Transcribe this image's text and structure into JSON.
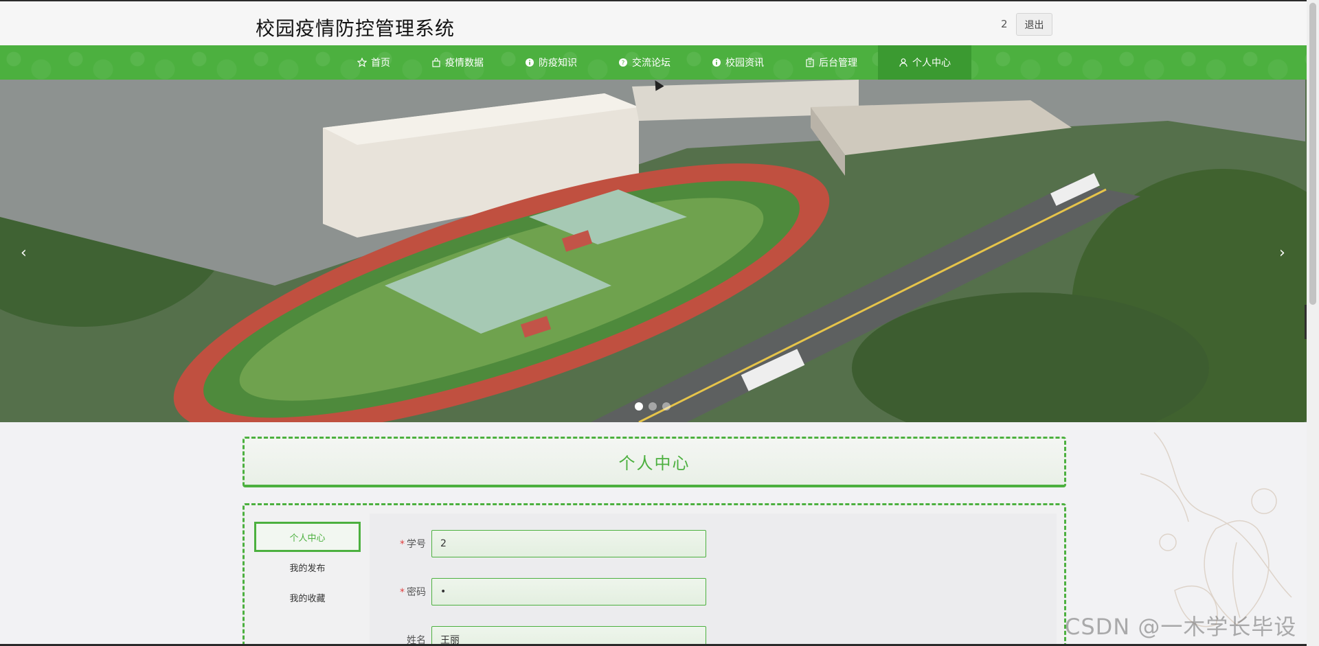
{
  "header": {
    "site_title": "校园疫情防控管理系统",
    "user_id": "2",
    "logout_label": "退出"
  },
  "nav": {
    "items": [
      {
        "label": "首页",
        "icon": "star-icon"
      },
      {
        "label": "疫情数据",
        "icon": "bag-icon"
      },
      {
        "label": "防疫知识",
        "icon": "info-circle-icon"
      },
      {
        "label": "交流论坛",
        "icon": "help-circle-icon"
      },
      {
        "label": "校园资讯",
        "icon": "info-circle-icon"
      },
      {
        "label": "后台管理",
        "icon": "building-icon"
      },
      {
        "label": "个人中心",
        "icon": "user-icon"
      }
    ],
    "active_index": 6
  },
  "banner": {
    "prev_arrow": "‹",
    "next_arrow": "›",
    "slide_count": 3,
    "active_slide": 1
  },
  "side_tab": {
    "icon": "chevron-left-icon",
    "glyph": "‹"
  },
  "page_heading": "个人中心",
  "side_menu": {
    "items": [
      "个人中心",
      "我的发布",
      "我的收藏"
    ],
    "active_index": 0
  },
  "form": {
    "student_id": {
      "label": "学号",
      "value": "2",
      "required": true
    },
    "password": {
      "label": "密码",
      "value": "•",
      "required": true
    },
    "name": {
      "label": "姓名",
      "value": "王丽",
      "required": false
    }
  },
  "watermark": "CSDN @一木学长毕设",
  "colors": {
    "accent": "#4cb03f",
    "accent_dark": "#3b9a31"
  }
}
